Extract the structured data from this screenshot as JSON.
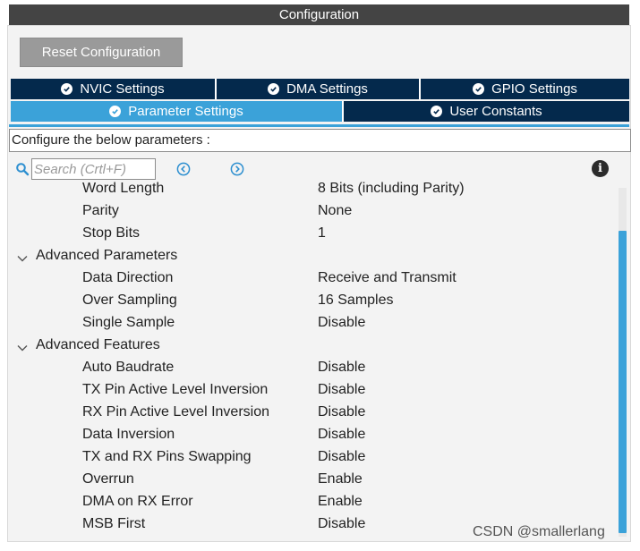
{
  "window": {
    "title": "Configuration"
  },
  "toolbar": {
    "reset_label": "Reset Configuration"
  },
  "tabs": [
    {
      "label": "NVIC Settings",
      "active": false
    },
    {
      "label": "DMA Settings",
      "active": false
    },
    {
      "label": "GPIO Settings",
      "active": false
    },
    {
      "label": "Parameter Settings",
      "active": true
    },
    {
      "label": "User Constants",
      "active": false
    }
  ],
  "description": "Configure the below parameters :",
  "search": {
    "placeholder": "Search (Crtl+F)",
    "value": ""
  },
  "icons": {
    "search": "search-icon",
    "previous": "chevron-left-circle-icon",
    "next": "chevron-right-circle-icon",
    "info": "info-icon",
    "check": "check-circle-icon",
    "expand": "chevron-down-icon"
  },
  "colors": {
    "title_bar": "#444444",
    "tab_inactive": "#04294c",
    "tab_active": "#3ba2d9",
    "accent": "#3ba2d9",
    "reset_button": "#9a9a9a"
  },
  "parameters": [
    {
      "type": "param",
      "name": "Word Length",
      "value": "8 Bits (including Parity)"
    },
    {
      "type": "param",
      "name": "Parity",
      "value": "None"
    },
    {
      "type": "param",
      "name": "Stop Bits",
      "value": "1"
    },
    {
      "type": "group",
      "name": "Advanced Parameters",
      "expanded": true
    },
    {
      "type": "param",
      "name": "Data Direction",
      "value": "Receive and Transmit"
    },
    {
      "type": "param",
      "name": "Over Sampling",
      "value": "16 Samples"
    },
    {
      "type": "param",
      "name": "Single Sample",
      "value": "Disable"
    },
    {
      "type": "group",
      "name": "Advanced Features",
      "expanded": true
    },
    {
      "type": "param",
      "name": "Auto Baudrate",
      "value": "Disable"
    },
    {
      "type": "param",
      "name": "TX Pin Active Level Inversion",
      "value": "Disable"
    },
    {
      "type": "param",
      "name": "RX Pin Active Level Inversion",
      "value": "Disable"
    },
    {
      "type": "param",
      "name": "Data Inversion",
      "value": "Disable"
    },
    {
      "type": "param",
      "name": "TX and RX Pins Swapping",
      "value": "Disable"
    },
    {
      "type": "param",
      "name": "Overrun",
      "value": "Enable"
    },
    {
      "type": "param",
      "name": "DMA on RX Error",
      "value": "Enable"
    },
    {
      "type": "param",
      "name": "MSB First",
      "value": "Disable"
    }
  ],
  "watermark": "CSDN @smallerlang"
}
